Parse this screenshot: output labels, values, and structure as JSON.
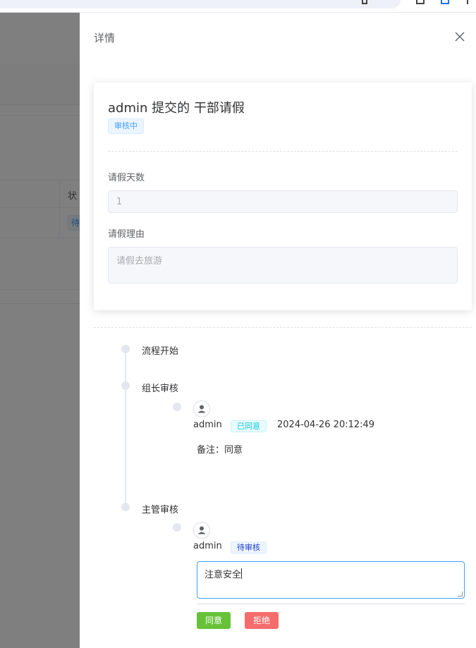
{
  "drawer": {
    "title": "详情"
  },
  "background": {
    "status_header": "状",
    "status_tag": "待"
  },
  "form": {
    "heading": "admin 提交的 干部请假",
    "status": "审核中",
    "fields": [
      {
        "label": "请假天数",
        "value": "1"
      },
      {
        "label": "请假理由",
        "value": "请假去旅游"
      }
    ]
  },
  "timeline": {
    "nodes": [
      {
        "label": "流程开始"
      },
      {
        "label": "组长审核",
        "approver": {
          "name": "admin",
          "status": "已同意",
          "time": "2024-04-26 20:12:49",
          "remark": "备注：同意"
        }
      },
      {
        "label": "主管审核",
        "approver": {
          "name": "admin",
          "status": "待审核"
        }
      }
    ]
  },
  "approval": {
    "comment_value": "注意安全",
    "agree_label": "同意",
    "reject_label": "拒绝"
  },
  "colors": {
    "primary": "#409eff",
    "success": "#67c23a",
    "danger": "#f56c6c",
    "info": "#909399"
  },
  "icons": [
    "close-icon",
    "user-avatar-icon"
  ]
}
